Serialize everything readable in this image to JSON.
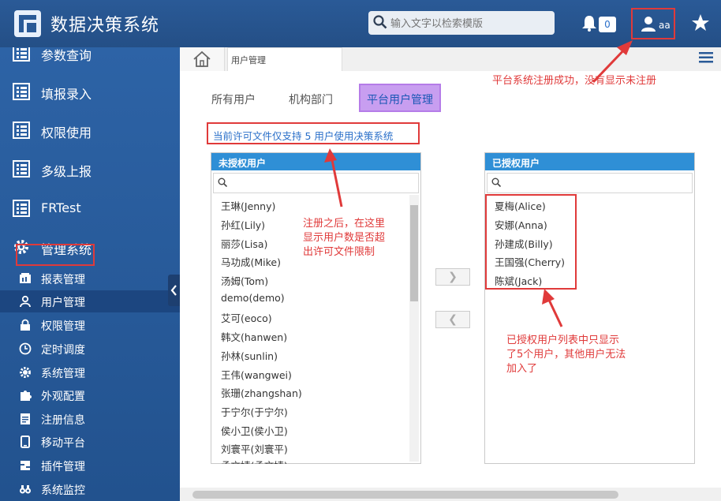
{
  "header": {
    "title": "数据决策系统",
    "search_placeholder": "输入文字以检索模版",
    "notification_count": "0",
    "username": "aa"
  },
  "sidebar": {
    "main_items": [
      {
        "label": "参数查询",
        "icon": "list-icon"
      },
      {
        "label": "填报录入",
        "icon": "list-icon"
      },
      {
        "label": "权限使用",
        "icon": "list-icon"
      },
      {
        "label": "多级上报",
        "icon": "list-icon"
      },
      {
        "label": "FRTest",
        "icon": "list-icon"
      },
      {
        "label": "管理系统",
        "icon": "gear-icon"
      }
    ],
    "sub_items": [
      {
        "label": "报表管理",
        "icon": "report-icon"
      },
      {
        "label": "用户管理",
        "icon": "user-icon"
      },
      {
        "label": "权限管理",
        "icon": "lock-icon"
      },
      {
        "label": "定时调度",
        "icon": "clock-icon"
      },
      {
        "label": "系统管理",
        "icon": "gear-icon"
      },
      {
        "label": "外观配置",
        "icon": "puzzle-icon"
      },
      {
        "label": "注册信息",
        "icon": "register-icon"
      },
      {
        "label": "移动平台",
        "icon": "mobile-icon"
      },
      {
        "label": "插件管理",
        "icon": "plugin-icon"
      },
      {
        "label": "系统监控",
        "icon": "binoculars-icon"
      }
    ]
  },
  "tabs": {
    "open_tab": "用户管理"
  },
  "subtabs": {
    "all_users": "所有用户",
    "org": "机构部门",
    "platform": "平台用户管理"
  },
  "license_notice": "当前许可文件仅支持 5 用户使用决策系统",
  "unauthorized": {
    "title": "未授权用户",
    "users": [
      "王琳(Jenny)",
      "孙红(Lily)",
      "丽莎(Lisa)",
      "马功成(Mike)",
      "汤姆(Tom)",
      "demo(demo)",
      "艾可(eoco)",
      "韩文(hanwen)",
      "孙林(sunlin)",
      "王伟(wangwei)",
      "张珊(zhangshan)",
      "于宁尔(于宁尔)",
      "侯小卫(侯小卫)",
      "刘寰平(刘寰平)",
      "孟文婧(孟文婧)"
    ]
  },
  "authorized": {
    "title": "已授权用户",
    "users": [
      "夏梅(Alice)",
      "安娜(Anna)",
      "孙建成(Billy)",
      "王国强(Cherry)",
      "陈斌(Jack)"
    ]
  },
  "buttons": {
    "add": "❯",
    "remove": "❮"
  },
  "annotations": {
    "top": "平台系统注册成功，没有显示未注册",
    "middle_1": "注册之后，在这里",
    "middle_2": "显示用户数是否超",
    "middle_3": "出许可文件限制",
    "bottom_1": "已授权用户列表中只显示",
    "bottom_2": "了5个用户，其他用户无法",
    "bottom_3": "加入了"
  },
  "colors": {
    "header": "#2a5a97",
    "accent": "#2f8fd6",
    "annotation": "#e03a3a",
    "platform_tab": "#c89ef0"
  }
}
